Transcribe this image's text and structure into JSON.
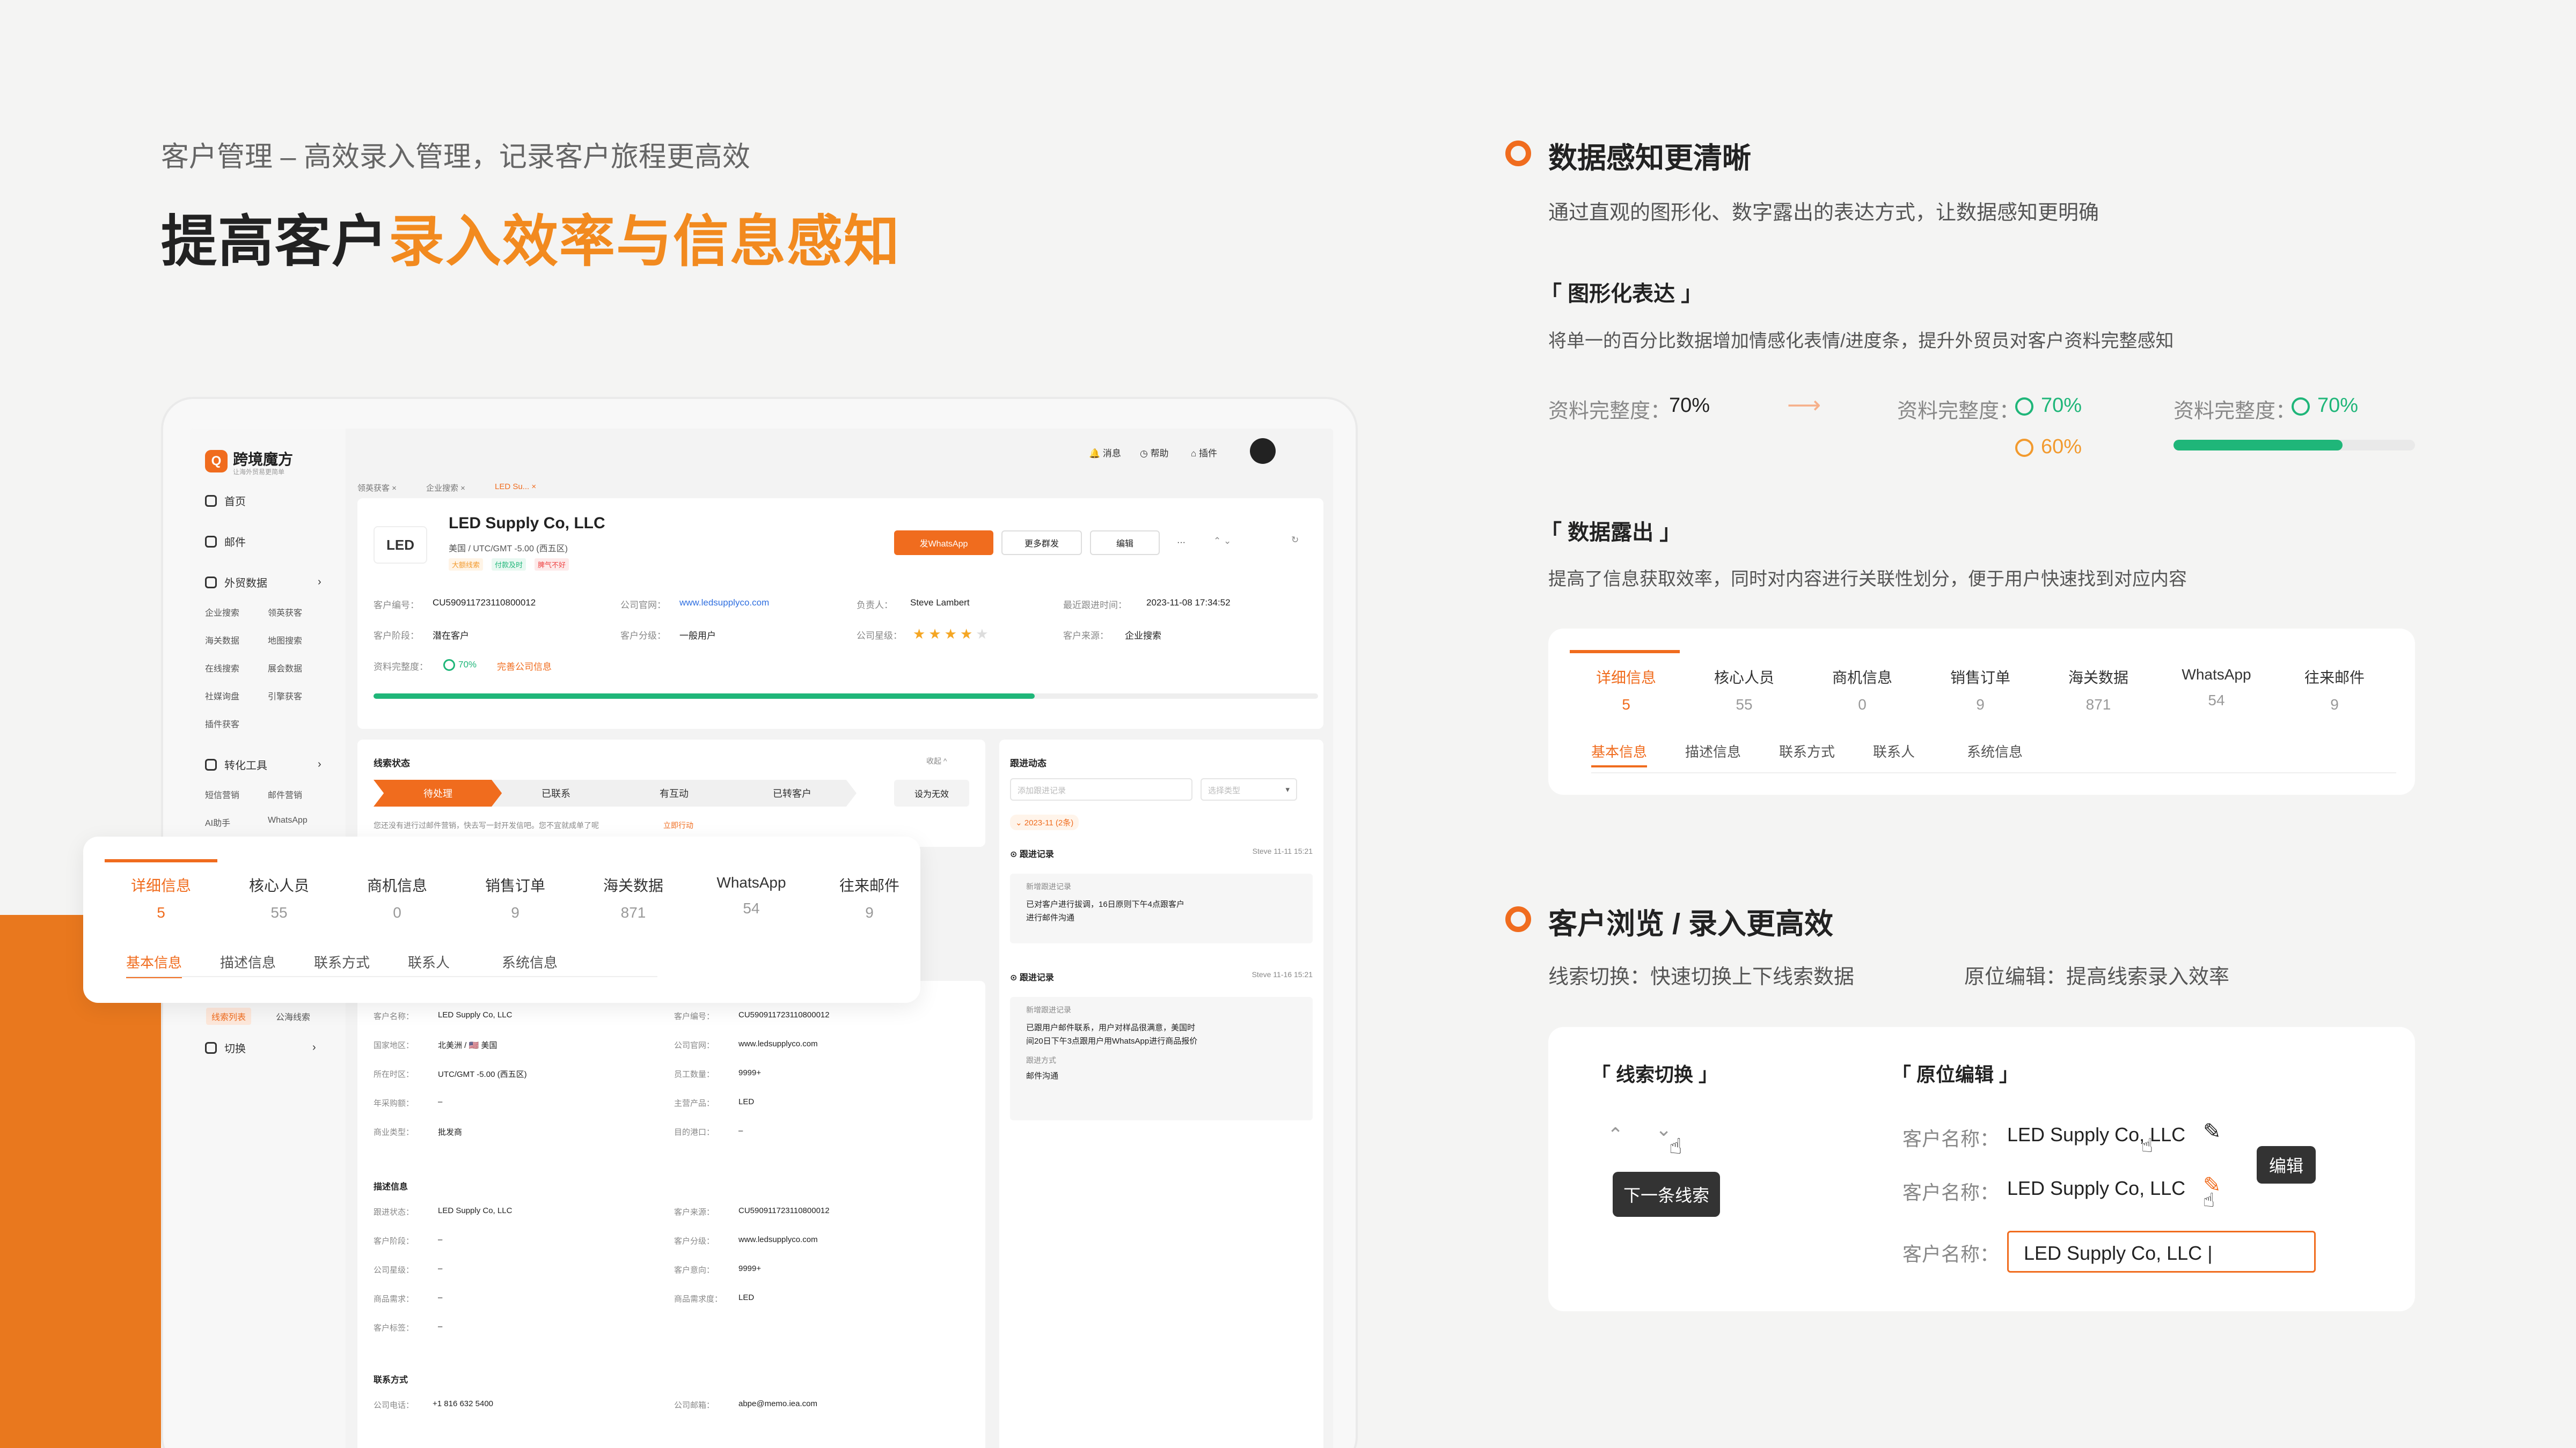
{
  "header": {
    "subtitle": "客户管理 – 高效录入管理，记录客户旅程更高效",
    "title_black": "提高客户",
    "title_orange": "录入效率与信息感知"
  },
  "app": {
    "brand": "跨境魔方",
    "brand_tagline": "让海外贸易更简单",
    "nav": {
      "home": "首页",
      "mail": "邮件",
      "foreign_data": "外贸数据",
      "convert_tools": "转化工具",
      "switch": "切换"
    },
    "foreign_sub": [
      "企业搜索",
      "领英获客",
      "海关数据",
      "地图搜索",
      "在线搜索",
      "展会数据",
      "社媒询盘",
      "引擎获客",
      "插件获客"
    ],
    "convert_sub": [
      "短信营销",
      "邮件营销",
      "AI助手",
      "WhatsApp"
    ],
    "side_tabs": [
      "线索列表",
      "公海线索"
    ],
    "topbar": {
      "msg": "消息",
      "help": "帮助",
      "plugin": "插件"
    },
    "page_tabs": [
      "领英获客",
      "企业搜索",
      "LED Su..."
    ],
    "company": {
      "name": "LED Supply Co, LLC",
      "location": "美国 / UTC/GMT -5.00 (西五区)",
      "tags": [
        "大额线索",
        "付款及时",
        "脾气不好"
      ],
      "logo_text": "LED"
    },
    "buttons": {
      "whatsapp": "发WhatsApp",
      "more": "更多群发",
      "edit": "编辑",
      "more_dots": "···"
    },
    "info": {
      "customer_no_label": "客户编号：",
      "customer_no": "CU590911723110800012",
      "website_label": "公司官网：",
      "website": "www.ledsupplyco.com",
      "owner_label": "负责人：",
      "owner": "Steve Lambert",
      "last_follow_label": "最近跟进时间：",
      "last_follow": "2023-11-08 17:34:52",
      "stage_label": "客户阶段：",
      "stage": "潜在客户",
      "level_label": "客户分级：",
      "level": "一般用户",
      "star_label": "公司星级：",
      "source_label": "客户来源：",
      "source": "企业搜索",
      "completeness_label": "资料完整度：",
      "completeness": "70%",
      "complete_link": "完善公司信息"
    },
    "completeness_fraction": 0.7,
    "star_rating": 4,
    "lead_status": {
      "title": "线索状态",
      "collapse": "收起 ^",
      "stages": [
        "待处理",
        "已联系",
        "有互动",
        "已转客户"
      ],
      "invalid": "设为无效",
      "hint": "您还没有进行过邮件营销，快去写一封开发信吧。您不宜就成单了呢",
      "hint_link": "立即行动"
    },
    "follow": {
      "title": "跟进动态",
      "search_ph": "添加跟进记录",
      "type_ph": "选择类型",
      "month": "2023-11",
      "month_count": "(2条)",
      "records": [
        {
          "title": "跟进记录",
          "user": "Steve",
          "time": "11-11 15:21",
          "sub_title": "新增跟进记录",
          "text1": "已对客户进行拔调，16日原则下午4点跟客户",
          "text2": "进行邮件沟通",
          "method_label": "",
          "method": ""
        },
        {
          "title": "跟进记录",
          "user": "Steve",
          "time": "11-16 15:21",
          "sub_title": "新增跟进记录",
          "text1": "已跟用户邮件联系，用户对样品很满意，美国时",
          "text2": "间20日下午3点跟用户用WhatsApp进行商品报价",
          "method_label": "跟进方式",
          "method": "邮件沟通"
        }
      ]
    },
    "detail_tabs": [
      {
        "label": "详细信息",
        "count": "5"
      },
      {
        "label": "核心人员",
        "count": "55"
      },
      {
        "label": "商机信息",
        "count": "0"
      },
      {
        "label": "销售订单",
        "count": "9"
      },
      {
        "label": "海关数据",
        "count": "871"
      },
      {
        "label": "WhatsApp",
        "count": "54"
      },
      {
        "label": "往来邮件",
        "count": "9"
      }
    ],
    "detail_subtabs": [
      "基本信息",
      "描述信息",
      "联系方式",
      "联系人",
      "系统信息"
    ],
    "basic": {
      "left": [
        [
          "客户名称：",
          "LED Supply Co, LLC"
        ],
        [
          "国家地区：",
          "北美洲 / 🇺🇸 美国"
        ],
        [
          "所在时区：",
          "UTC/GMT -5.00 (西五区)"
        ],
        [
          "年采购额：",
          "–"
        ],
        [
          "商业类型：",
          "批发商"
        ]
      ],
      "right": [
        [
          "客户编号：",
          "CU590911723110800012"
        ],
        [
          "公司官网：",
          "www.ledsupplyco.com"
        ],
        [
          "员工数量：",
          "9999+"
        ],
        [
          "主营产品：",
          "LED"
        ],
        [
          "目的港口：",
          "–"
        ]
      ]
    },
    "desc": {
      "title": "描述信息",
      "left": [
        [
          "跟进状态：",
          "LED Supply Co, LLC"
        ],
        [
          "客户阶段：",
          "–"
        ],
        [
          "公司星级：",
          "–"
        ],
        [
          "商品需求：",
          "–"
        ],
        [
          "客户标签：",
          "–"
        ]
      ],
      "right": [
        [
          "客户来源：",
          "CU590911723110800012"
        ],
        [
          "客户分级：",
          "www.ledsupplyco.com"
        ],
        [
          "客户意向：",
          "9999+"
        ],
        [
          "商品需求度：",
          "LED"
        ]
      ]
    },
    "contact": {
      "title": "联系方式",
      "phone_label": "公司电话：",
      "phone": "+1 816 632 5400",
      "email_label": "公司邮箱：",
      "email": "abpe@memo.iea.com"
    }
  },
  "right": {
    "sec1": {
      "title": "数据感知更清晰",
      "desc": "通过直观的图形化、数字露出的表达方式，让数据感知更明确",
      "h1": "「 图形化表达 」",
      "h1_desc": "将单一的百分比数据增加情感化表情/进度条，提升外贸员对客户资料完整感知",
      "label": "资料完整度：",
      "v_plain": "70%",
      "v_good": "70%",
      "v_warn": "60%",
      "v_bar": "70%",
      "bar_fraction": 0.7,
      "h2": "「 数据露出 」",
      "h2_desc": "提高了信息获取效率，同时对内容进行关联性划分，便于用户快速找到对应内容"
    },
    "sec2": {
      "title": "客户浏览 / 录入更高效",
      "feat1": "线索切换：快速切换上下线索数据",
      "feat2": "原位编辑：提高线索录入效率",
      "h1": "「 线索切换 」",
      "tip_next": "下一条线索",
      "h2": "「 原位编辑 」",
      "label": "客户名称：",
      "value": "LED Supply Co, LLC",
      "tip_edit": "编辑"
    }
  },
  "colors": {
    "accent": "#f06c1e",
    "orange_title": "#f28a1f",
    "green": "#1fb679",
    "warn": "#f29a2e"
  }
}
